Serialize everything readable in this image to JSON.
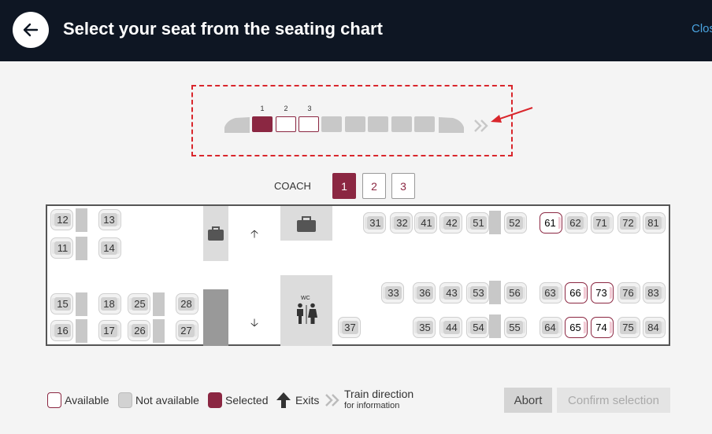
{
  "header": {
    "title": "Select your seat from the seating chart",
    "close_label": "Close"
  },
  "train_overview": {
    "coach_numbers": [
      "1",
      "2",
      "3"
    ],
    "selected_coach": "1",
    "wagon_count": 8
  },
  "coach_selector": {
    "label": "COACH",
    "options": [
      "1",
      "2",
      "3"
    ],
    "active": "1"
  },
  "seats": [
    {
      "n": "12",
      "status": "unavailable"
    },
    {
      "n": "13",
      "status": "unavailable"
    },
    {
      "n": "11",
      "status": "unavailable"
    },
    {
      "n": "14",
      "status": "unavailable"
    },
    {
      "n": "15",
      "status": "unavailable"
    },
    {
      "n": "18",
      "status": "unavailable"
    },
    {
      "n": "16",
      "status": "unavailable"
    },
    {
      "n": "17",
      "status": "unavailable"
    },
    {
      "n": "25",
      "status": "unavailable"
    },
    {
      "n": "28",
      "status": "unavailable"
    },
    {
      "n": "26",
      "status": "unavailable"
    },
    {
      "n": "27",
      "status": "unavailable"
    },
    {
      "n": "31",
      "status": "unavailable"
    },
    {
      "n": "32",
      "status": "unavailable"
    },
    {
      "n": "41",
      "status": "unavailable"
    },
    {
      "n": "42",
      "status": "unavailable"
    },
    {
      "n": "51",
      "status": "unavailable"
    },
    {
      "n": "52",
      "status": "unavailable"
    },
    {
      "n": "61",
      "status": "available"
    },
    {
      "n": "62",
      "status": "unavailable"
    },
    {
      "n": "71",
      "status": "unavailable"
    },
    {
      "n": "72",
      "status": "unavailable"
    },
    {
      "n": "81",
      "status": "unavailable"
    },
    {
      "n": "33",
      "status": "unavailable"
    },
    {
      "n": "36",
      "status": "unavailable"
    },
    {
      "n": "43",
      "status": "unavailable"
    },
    {
      "n": "53",
      "status": "unavailable"
    },
    {
      "n": "56",
      "status": "unavailable"
    },
    {
      "n": "63",
      "status": "unavailable"
    },
    {
      "n": "66",
      "status": "available"
    },
    {
      "n": "73",
      "status": "available"
    },
    {
      "n": "76",
      "status": "unavailable"
    },
    {
      "n": "83",
      "status": "unavailable"
    },
    {
      "n": "37",
      "status": "unavailable"
    },
    {
      "n": "35",
      "status": "unavailable"
    },
    {
      "n": "44",
      "status": "unavailable"
    },
    {
      "n": "54",
      "status": "unavailable"
    },
    {
      "n": "55",
      "status": "unavailable"
    },
    {
      "n": "64",
      "status": "unavailable"
    },
    {
      "n": "65",
      "status": "available"
    },
    {
      "n": "74",
      "status": "available"
    },
    {
      "n": "75",
      "status": "unavailable"
    },
    {
      "n": "84",
      "status": "unavailable"
    }
  ],
  "facilities": {
    "wc_label": "WC"
  },
  "legend": {
    "available": "Available",
    "not_available": "Not available",
    "selected": "Selected",
    "exits": "Exits",
    "train_direction": "Train direction",
    "for_information": "for information"
  },
  "buttons": {
    "abort": "Abort",
    "confirm": "Confirm selection"
  },
  "colors": {
    "header_bg": "#0e1623",
    "accent": "#8b2742",
    "highlight_red": "#d9262c",
    "link": "#4aa3df"
  }
}
